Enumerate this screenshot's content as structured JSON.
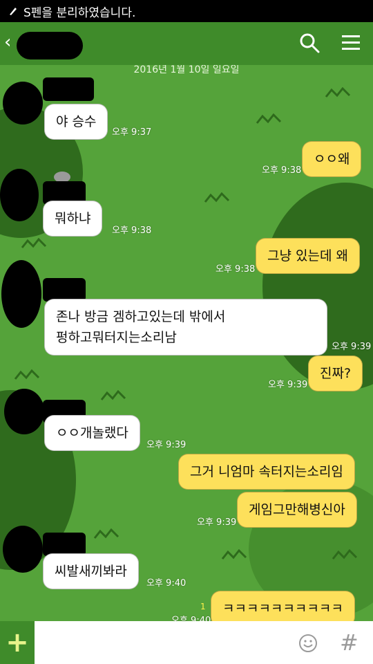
{
  "status_bar": {
    "notification": "S펜을 분리하였습니다."
  },
  "header": {
    "title": ""
  },
  "date_divider": "2016년 1월 10일 일요일",
  "messages": [
    {
      "dir": "in",
      "text": "야 승수",
      "time": "오후 9:37"
    },
    {
      "dir": "out",
      "text": "ㅇㅇ왜",
      "time": "오후 9:38"
    },
    {
      "dir": "in",
      "text": "뭐하냐",
      "time": "오후 9:38"
    },
    {
      "dir": "out",
      "text": "그냥 있는데 왜",
      "time": "오후 9:38"
    },
    {
      "dir": "in",
      "text_line1": "존나 방금 겜하고있는데 밖에서",
      "text_line2": "펑하고뭐터지는소리남",
      "time": "오후 9:39"
    },
    {
      "dir": "out",
      "text": "진짜?",
      "time": "오후 9:39"
    },
    {
      "dir": "in",
      "text": "ㅇㅇ개놀랬다",
      "time": "오후 9:39"
    },
    {
      "dir": "out",
      "text": "그거 니엄마 속터지는소리임"
    },
    {
      "dir": "out",
      "text": "게임그만해병신아",
      "time": "오후 9:39"
    },
    {
      "dir": "in",
      "text": "씨발새끼봐라",
      "time": "오후 9:40"
    },
    {
      "dir": "out",
      "text": "ㅋㅋㅋㅋㅋㅋㅋㅋㅋㅋ",
      "time": "오후 9:40",
      "unread": "1"
    }
  ],
  "input": {
    "placeholder": ""
  },
  "icons": {
    "back": "chevron-left-icon",
    "search": "search-icon",
    "menu": "menu-icon",
    "plus": "plus-icon",
    "emoji": "emoji-icon",
    "hash": "hash-icon"
  },
  "colors": {
    "header": "#3f8b2a",
    "chat_bg": "#55a33a",
    "bubble_out": "#fde05b",
    "bubble_in": "#ffffff"
  }
}
